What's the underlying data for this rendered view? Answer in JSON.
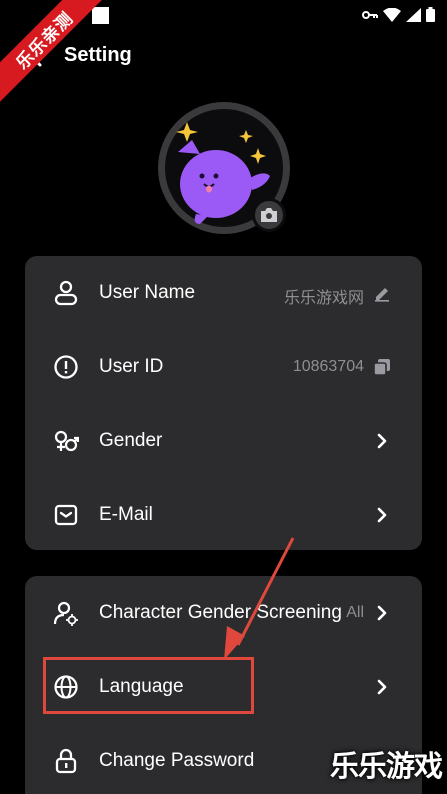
{
  "watermark": {
    "ribbon_text": "乐乐亲测",
    "bottom_text": "乐乐游戏"
  },
  "header": {
    "title": "Setting",
    "back_icon": "chevron-left-icon"
  },
  "avatar": {
    "color": "#9b59f5",
    "camera_icon": "camera-icon"
  },
  "account_card": {
    "rows": [
      {
        "label": "User Name",
        "value": "乐乐游戏网",
        "icon": "user-icon",
        "trailing_icon": "pencil-icon"
      },
      {
        "label": "User ID",
        "value": "10863704",
        "icon": "info-circle-icon",
        "trailing_icon": "copy-icon"
      },
      {
        "label": "Gender",
        "value": "",
        "icon": "gender-icon",
        "trailing_icon": "chevron-right-icon"
      },
      {
        "label": "E-Mail",
        "value": "",
        "icon": "mail-icon",
        "trailing_icon": "chevron-right-icon"
      }
    ]
  },
  "preferences_card": {
    "rows": [
      {
        "label": "Character Gender Screening",
        "value": "All",
        "icon": "character-filter-icon",
        "trailing_icon": "chevron-right-icon"
      },
      {
        "label": "Language",
        "value": "",
        "icon": "globe-icon",
        "trailing_icon": "chevron-right-icon"
      },
      {
        "label": "Change Password",
        "value": "",
        "icon": "lock-icon",
        "trailing_icon": ""
      }
    ]
  },
  "colors": {
    "background": "#000000",
    "card": "#2c2c2e",
    "secondary_text": "#8e8e93",
    "annotation": "#e0483d",
    "ribbon": "#d61a1f"
  }
}
